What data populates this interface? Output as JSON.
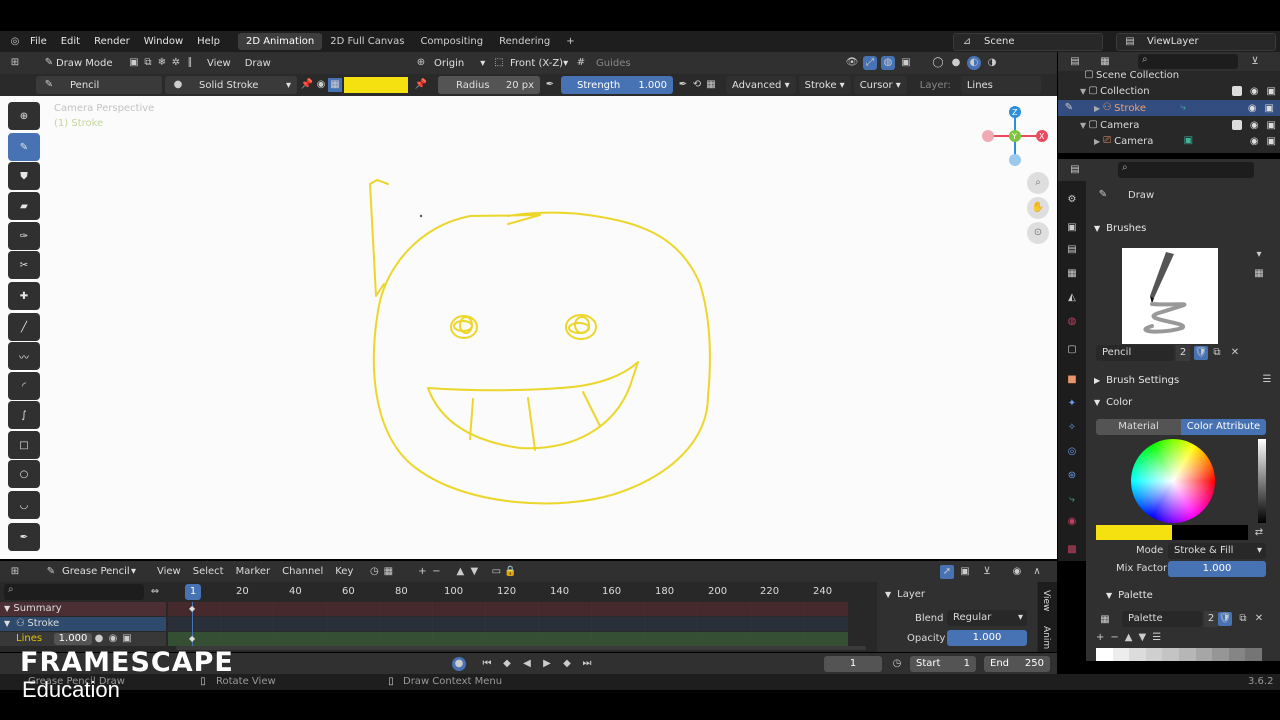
{
  "topbar": {
    "menus": [
      "File",
      "Edit",
      "Render",
      "Window",
      "Help"
    ],
    "workspaces": [
      "2D Animation",
      "2D Full Canvas",
      "Compositing",
      "Rendering"
    ],
    "active_workspace": "2D Animation",
    "add": "+",
    "scene": "Scene",
    "view_layer": "ViewLayer"
  },
  "header": {
    "mode": "Draw Mode",
    "view": "View",
    "draw": "Draw",
    "origin": "Origin",
    "front": "Front (X-Z)",
    "guides": "Guides"
  },
  "toolsettings": {
    "brush": "Pencil",
    "material": "Solid Stroke",
    "color": "#f5e010",
    "radius_label": "Radius",
    "radius": "20 px",
    "strength_label": "Strength",
    "strength": "1.000",
    "advanced": "Advanced",
    "stroke": "Stroke",
    "cursor": "Cursor",
    "layer_label": "Layer:",
    "layer": "Lines"
  },
  "viewport": {
    "perspective": "Camera Perspective",
    "object": "(1) Stroke"
  },
  "outliner": {
    "items": [
      {
        "label": "Scene Collection"
      },
      {
        "label": "Collection"
      },
      {
        "label": "Stroke"
      },
      {
        "label": "Camera"
      },
      {
        "label": "Camera"
      }
    ]
  },
  "properties": {
    "tool": "Draw",
    "brushes": "Brushes",
    "brush_name": "Pencil",
    "brush_users": "2",
    "brush_settings": "Brush Settings",
    "color": "Color",
    "tab_material": "Material",
    "tab_attribute": "Color Attribute",
    "mode_label": "Mode",
    "mode_value": "Stroke & Fill",
    "mix_label": "Mix Factor",
    "mix_value": "1.000",
    "palette": "Palette",
    "palette_name": "Palette",
    "palette_users": "2",
    "primary": "#f5e010"
  },
  "timeline": {
    "editor": "Grease Pencil",
    "menus": [
      "View",
      "Select",
      "Marker",
      "Channel",
      "Key"
    ],
    "ticks": [
      "1",
      "20",
      "40",
      "60",
      "80",
      "100",
      "120",
      "140",
      "160",
      "180",
      "200",
      "220",
      "240"
    ],
    "summary": "Summary",
    "stroke": "Stroke",
    "lines": "Lines",
    "lines_value": "1.000",
    "layer_panel": "Layer",
    "blend_label": "Blend",
    "blend": "Regular",
    "opacity_label": "Opacity",
    "opacity": "1.000",
    "tab_view": "View",
    "tab_anim": "Anim"
  },
  "playback": {
    "frame": "1",
    "start_label": "Start",
    "start": "1",
    "end_label": "End",
    "end": "250"
  },
  "status": {
    "left": "Grease Pencil Draw",
    "middle": "Rotate View",
    "right": "Draw Context Menu",
    "version": "3.6.2"
  },
  "watermark": {
    "brand": "FRAMESCAPE",
    "sub": "Education"
  }
}
